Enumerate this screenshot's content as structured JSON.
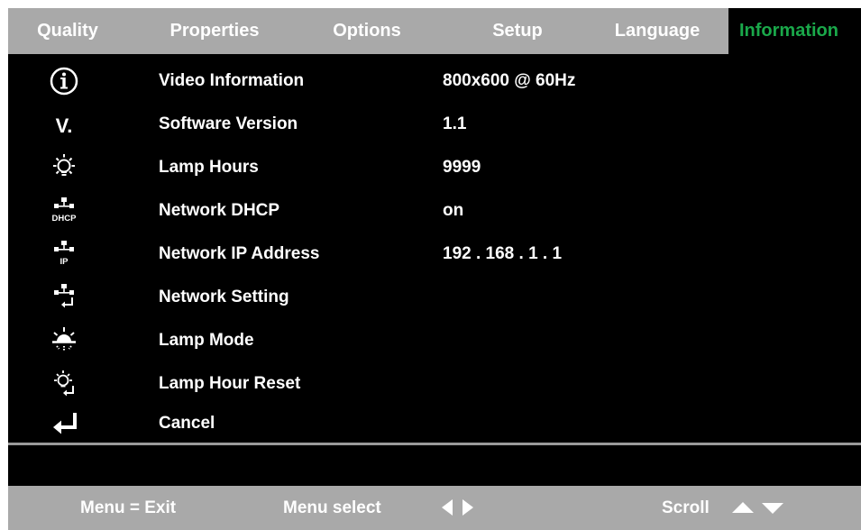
{
  "tabs": [
    {
      "label": "Quality",
      "active": false
    },
    {
      "label": "Properties",
      "active": false
    },
    {
      "label": "Options",
      "active": false
    },
    {
      "label": "Setup",
      "active": false
    },
    {
      "label": "Language",
      "active": false
    },
    {
      "label": "Information",
      "active": true
    }
  ],
  "items": [
    {
      "icon": "info-icon",
      "label": "Video Information",
      "value": "800x600 @ 60Hz"
    },
    {
      "icon": "version-icon",
      "label": "Software Version",
      "value": "1.1",
      "icon_text": "V."
    },
    {
      "icon": "lamp-bulb-icon",
      "label": "Lamp Hours",
      "value": "9999"
    },
    {
      "icon": "network-dhcp-icon",
      "label": "Network DHCP",
      "value": "on",
      "icon_text": "DHCP"
    },
    {
      "icon": "network-ip-icon",
      "label": "Network IP Address",
      "value": "192 . 168 . 1 . 1",
      "icon_text": "IP"
    },
    {
      "icon": "network-setting-icon",
      "label": "Network Setting",
      "value": ""
    },
    {
      "icon": "lamp-mode-icon",
      "label": "Lamp Mode",
      "value": ""
    },
    {
      "icon": "lamp-reset-icon",
      "label": "Lamp Hour Reset",
      "value": ""
    },
    {
      "icon": "enter-arrow-icon",
      "label": "Cancel",
      "value": ""
    }
  ],
  "footer": {
    "exit": "Menu = Exit",
    "menu_select": "Menu select",
    "scroll": "Scroll"
  },
  "colors": {
    "background": "#000000",
    "bar": "#a9a9a9",
    "text": "#ffffff",
    "active_tab": "#1aa84a"
  }
}
